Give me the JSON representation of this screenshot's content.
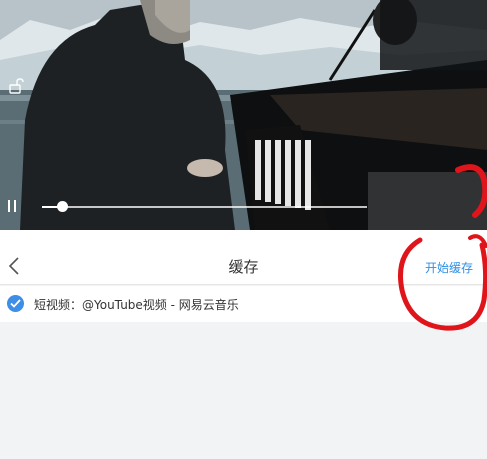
{
  "player": {
    "state": "paused",
    "progress_fraction": 0.06,
    "lock_icon": "unlock-icon",
    "pause_icon": "pause-icon"
  },
  "header": {
    "back_icon": "chevron-left-icon",
    "title": "缓存",
    "start_label": "开始缓存"
  },
  "list": {
    "items": [
      {
        "selected": true,
        "label": "短视频：@YouTube视频 - 网易云音乐"
      }
    ]
  },
  "colors": {
    "accent": "#2f8fe6",
    "check": "#3d8ee6",
    "annotation": "#e0151b"
  }
}
